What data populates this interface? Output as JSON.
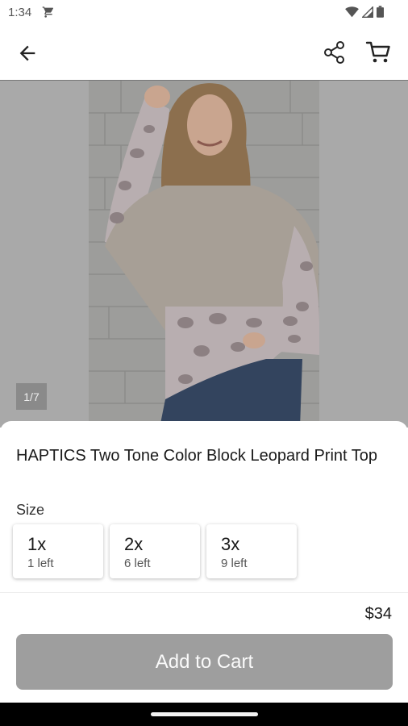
{
  "status_bar": {
    "time": "1:34"
  },
  "product": {
    "title": "HAPTICS Two Tone Color Block Leopard Print Top",
    "image_counter": "1/7",
    "price": "$34"
  },
  "size_section": {
    "label": "Size",
    "options": [
      {
        "size": "1x",
        "stock": "1 left"
      },
      {
        "size": "2x",
        "stock": "6 left"
      },
      {
        "size": "3x",
        "stock": "9 left"
      }
    ]
  },
  "actions": {
    "add_to_cart_label": "Add to Cart"
  },
  "colors": {
    "button_bg": "#9e9e9e",
    "gallery_bg": "#a9a9a9",
    "sweater_grey": "#a79f96",
    "leopard_pink": "#b8aeb0"
  }
}
